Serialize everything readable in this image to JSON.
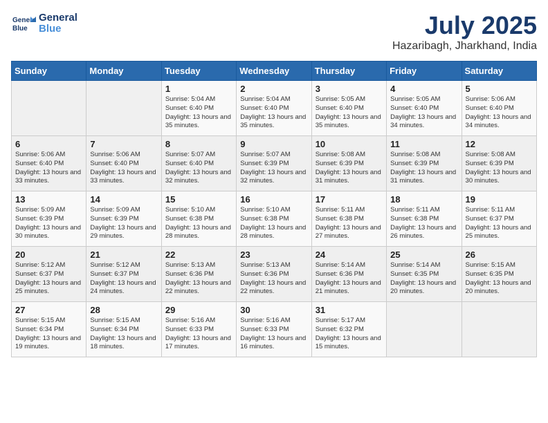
{
  "header": {
    "logo_line1": "General",
    "logo_line2": "Blue",
    "month": "July 2025",
    "location": "Hazaribagh, Jharkhand, India"
  },
  "weekdays": [
    "Sunday",
    "Monday",
    "Tuesday",
    "Wednesday",
    "Thursday",
    "Friday",
    "Saturday"
  ],
  "weeks": [
    [
      {
        "day": "",
        "text": ""
      },
      {
        "day": "",
        "text": ""
      },
      {
        "day": "1",
        "text": "Sunrise: 5:04 AM\nSunset: 6:40 PM\nDaylight: 13 hours and 35 minutes."
      },
      {
        "day": "2",
        "text": "Sunrise: 5:04 AM\nSunset: 6:40 PM\nDaylight: 13 hours and 35 minutes."
      },
      {
        "day": "3",
        "text": "Sunrise: 5:05 AM\nSunset: 6:40 PM\nDaylight: 13 hours and 35 minutes."
      },
      {
        "day": "4",
        "text": "Sunrise: 5:05 AM\nSunset: 6:40 PM\nDaylight: 13 hours and 34 minutes."
      },
      {
        "day": "5",
        "text": "Sunrise: 5:06 AM\nSunset: 6:40 PM\nDaylight: 13 hours and 34 minutes."
      }
    ],
    [
      {
        "day": "6",
        "text": "Sunrise: 5:06 AM\nSunset: 6:40 PM\nDaylight: 13 hours and 33 minutes."
      },
      {
        "day": "7",
        "text": "Sunrise: 5:06 AM\nSunset: 6:40 PM\nDaylight: 13 hours and 33 minutes."
      },
      {
        "day": "8",
        "text": "Sunrise: 5:07 AM\nSunset: 6:40 PM\nDaylight: 13 hours and 32 minutes."
      },
      {
        "day": "9",
        "text": "Sunrise: 5:07 AM\nSunset: 6:39 PM\nDaylight: 13 hours and 32 minutes."
      },
      {
        "day": "10",
        "text": "Sunrise: 5:08 AM\nSunset: 6:39 PM\nDaylight: 13 hours and 31 minutes."
      },
      {
        "day": "11",
        "text": "Sunrise: 5:08 AM\nSunset: 6:39 PM\nDaylight: 13 hours and 31 minutes."
      },
      {
        "day": "12",
        "text": "Sunrise: 5:08 AM\nSunset: 6:39 PM\nDaylight: 13 hours and 30 minutes."
      }
    ],
    [
      {
        "day": "13",
        "text": "Sunrise: 5:09 AM\nSunset: 6:39 PM\nDaylight: 13 hours and 30 minutes."
      },
      {
        "day": "14",
        "text": "Sunrise: 5:09 AM\nSunset: 6:39 PM\nDaylight: 13 hours and 29 minutes."
      },
      {
        "day": "15",
        "text": "Sunrise: 5:10 AM\nSunset: 6:38 PM\nDaylight: 13 hours and 28 minutes."
      },
      {
        "day": "16",
        "text": "Sunrise: 5:10 AM\nSunset: 6:38 PM\nDaylight: 13 hours and 28 minutes."
      },
      {
        "day": "17",
        "text": "Sunrise: 5:11 AM\nSunset: 6:38 PM\nDaylight: 13 hours and 27 minutes."
      },
      {
        "day": "18",
        "text": "Sunrise: 5:11 AM\nSunset: 6:38 PM\nDaylight: 13 hours and 26 minutes."
      },
      {
        "day": "19",
        "text": "Sunrise: 5:11 AM\nSunset: 6:37 PM\nDaylight: 13 hours and 25 minutes."
      }
    ],
    [
      {
        "day": "20",
        "text": "Sunrise: 5:12 AM\nSunset: 6:37 PM\nDaylight: 13 hours and 25 minutes."
      },
      {
        "day": "21",
        "text": "Sunrise: 5:12 AM\nSunset: 6:37 PM\nDaylight: 13 hours and 24 minutes."
      },
      {
        "day": "22",
        "text": "Sunrise: 5:13 AM\nSunset: 6:36 PM\nDaylight: 13 hours and 22 minutes."
      },
      {
        "day": "23",
        "text": "Sunrise: 5:13 AM\nSunset: 6:36 PM\nDaylight: 13 hours and 22 minutes."
      },
      {
        "day": "24",
        "text": "Sunrise: 5:14 AM\nSunset: 6:36 PM\nDaylight: 13 hours and 21 minutes."
      },
      {
        "day": "25",
        "text": "Sunrise: 5:14 AM\nSunset: 6:35 PM\nDaylight: 13 hours and 20 minutes."
      },
      {
        "day": "26",
        "text": "Sunrise: 5:15 AM\nSunset: 6:35 PM\nDaylight: 13 hours and 20 minutes."
      }
    ],
    [
      {
        "day": "27",
        "text": "Sunrise: 5:15 AM\nSunset: 6:34 PM\nDaylight: 13 hours and 19 minutes."
      },
      {
        "day": "28",
        "text": "Sunrise: 5:15 AM\nSunset: 6:34 PM\nDaylight: 13 hours and 18 minutes."
      },
      {
        "day": "29",
        "text": "Sunrise: 5:16 AM\nSunset: 6:33 PM\nDaylight: 13 hours and 17 minutes."
      },
      {
        "day": "30",
        "text": "Sunrise: 5:16 AM\nSunset: 6:33 PM\nDaylight: 13 hours and 16 minutes."
      },
      {
        "day": "31",
        "text": "Sunrise: 5:17 AM\nSunset: 6:32 PM\nDaylight: 13 hours and 15 minutes."
      },
      {
        "day": "",
        "text": ""
      },
      {
        "day": "",
        "text": ""
      }
    ]
  ]
}
